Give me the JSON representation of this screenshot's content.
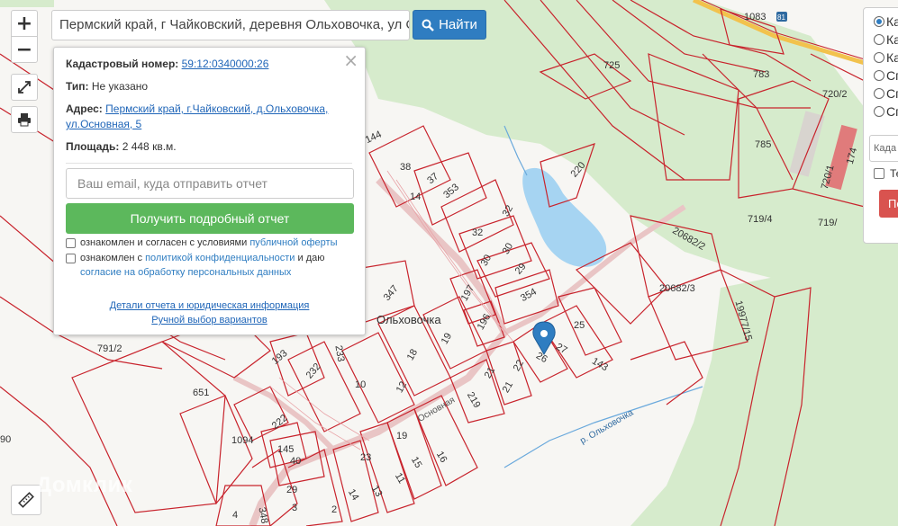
{
  "search": {
    "value": "Пермский край, г Чайковский, деревня Ольховочка, ул Осн",
    "button_label": "Найти",
    "button_icon": "search-icon"
  },
  "map_controls": {
    "zoom_in": "+",
    "zoom_out": "−",
    "fullscreen_icon": "expand-icon",
    "print_icon": "printer-icon",
    "ruler_icon": "ruler-icon"
  },
  "popup": {
    "close": "×",
    "cadastral_label": "Кадастровый номер:",
    "cadastral_value": "59:12:0340000:26",
    "type_label": "Тип:",
    "type_value": "Не указано",
    "address_label": "Адрес:",
    "address_value_line1": "Пермский край, г.Чайковский, д.Ольховочка,",
    "address_value_line2": "ул.Основная, 5",
    "area_label": "Площадь:",
    "area_value": "2 448 кв.м.",
    "email_placeholder": "Ваш email, куда отправить отчет",
    "report_button": "Получить подробный отчет",
    "consent1_text": "ознакомлен и согласен с условиями ",
    "consent1_link": "публичной оферты",
    "consent2_text_a": "ознакомлен с ",
    "consent2_link_a": "политикой конфиденциальности",
    "consent2_text_b": " и даю",
    "consent2_link_b": "согласие на обработку персональных данных",
    "details_link": "Детали отчета и юридическая информация",
    "manual_link": "Ручной выбор вариантов"
  },
  "layers_panel": {
    "options": [
      "Ка",
      "Ка",
      "Ка",
      "Сп",
      "Сп",
      "Сп"
    ],
    "selected_index": 0,
    "input_placeholder": "Када",
    "checkbox_label": "Те",
    "button_label": "По"
  },
  "map": {
    "village_label": "Ольховочка",
    "street_label": "Основная",
    "river_label": "р. Ольховочка",
    "road_shield": "81",
    "watermark": "Домклик",
    "parcel_labels": [
      "1083",
      "725",
      "783",
      "720/2",
      "785",
      "720/1",
      "174",
      "719/4",
      "719/",
      "20682/2",
      "20682/3",
      "19977/15",
      "791/2",
      "651",
      "1094",
      "90",
      "144",
      "38",
      "37",
      "14",
      "353",
      "220",
      "32",
      "32",
      "30",
      "30",
      "29",
      "197",
      "354",
      "347",
      "196",
      "19",
      "25",
      "27",
      "26",
      "143",
      "193",
      "233",
      "232",
      "10",
      "12",
      "18",
      "22",
      "21",
      "21",
      "219",
      "222",
      "145",
      "40",
      "23",
      "19",
      "15",
      "16",
      "11",
      "13",
      "14",
      "2",
      "3",
      "4",
      "348",
      "29"
    ],
    "colors": {
      "parcel_line": "#c8232c",
      "background": "#f2efe9",
      "forest": "#cfe8c4",
      "water": "#aad3f0",
      "marker": "#2f7dc1",
      "road_main": "#f2c24d"
    }
  }
}
